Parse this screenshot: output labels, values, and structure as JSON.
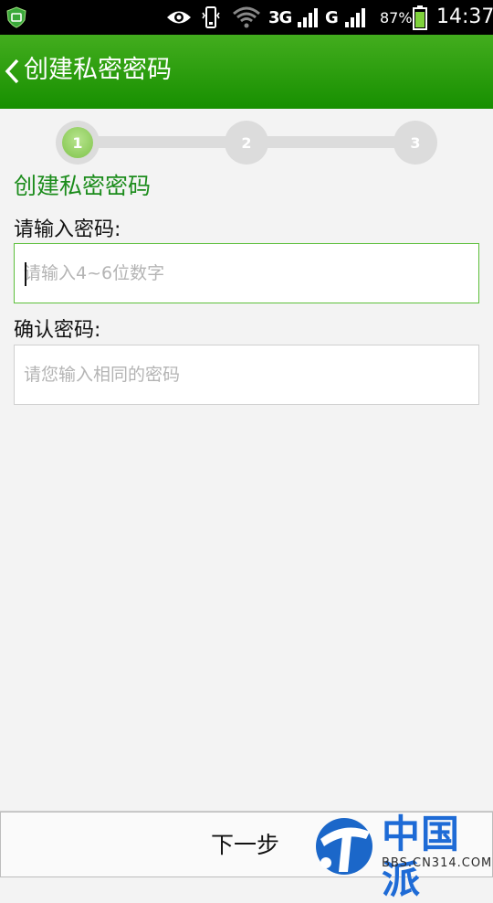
{
  "status_bar": {
    "network_3g": "3G",
    "network_g": "G",
    "battery_percent": "87%",
    "time": "14:37"
  },
  "action_bar": {
    "title": "创建私密密码",
    "background_color": "#2a9c10"
  },
  "stepper": {
    "current_step": 1,
    "steps": [
      "1",
      "2",
      "3"
    ],
    "active_color": "#8fcf5a"
  },
  "form": {
    "section_title": "创建私密密码",
    "password_label": "请输入密码:",
    "password_placeholder": "请输入4~6位数字",
    "password_value": "",
    "confirm_label": "确认密码:",
    "confirm_placeholder": "请您输入相同的密码",
    "confirm_value": ""
  },
  "bottom_bar": {
    "next_label": "下一步"
  },
  "watermark": {
    "name": "中国派",
    "url": "BBS.CN314.COM"
  }
}
